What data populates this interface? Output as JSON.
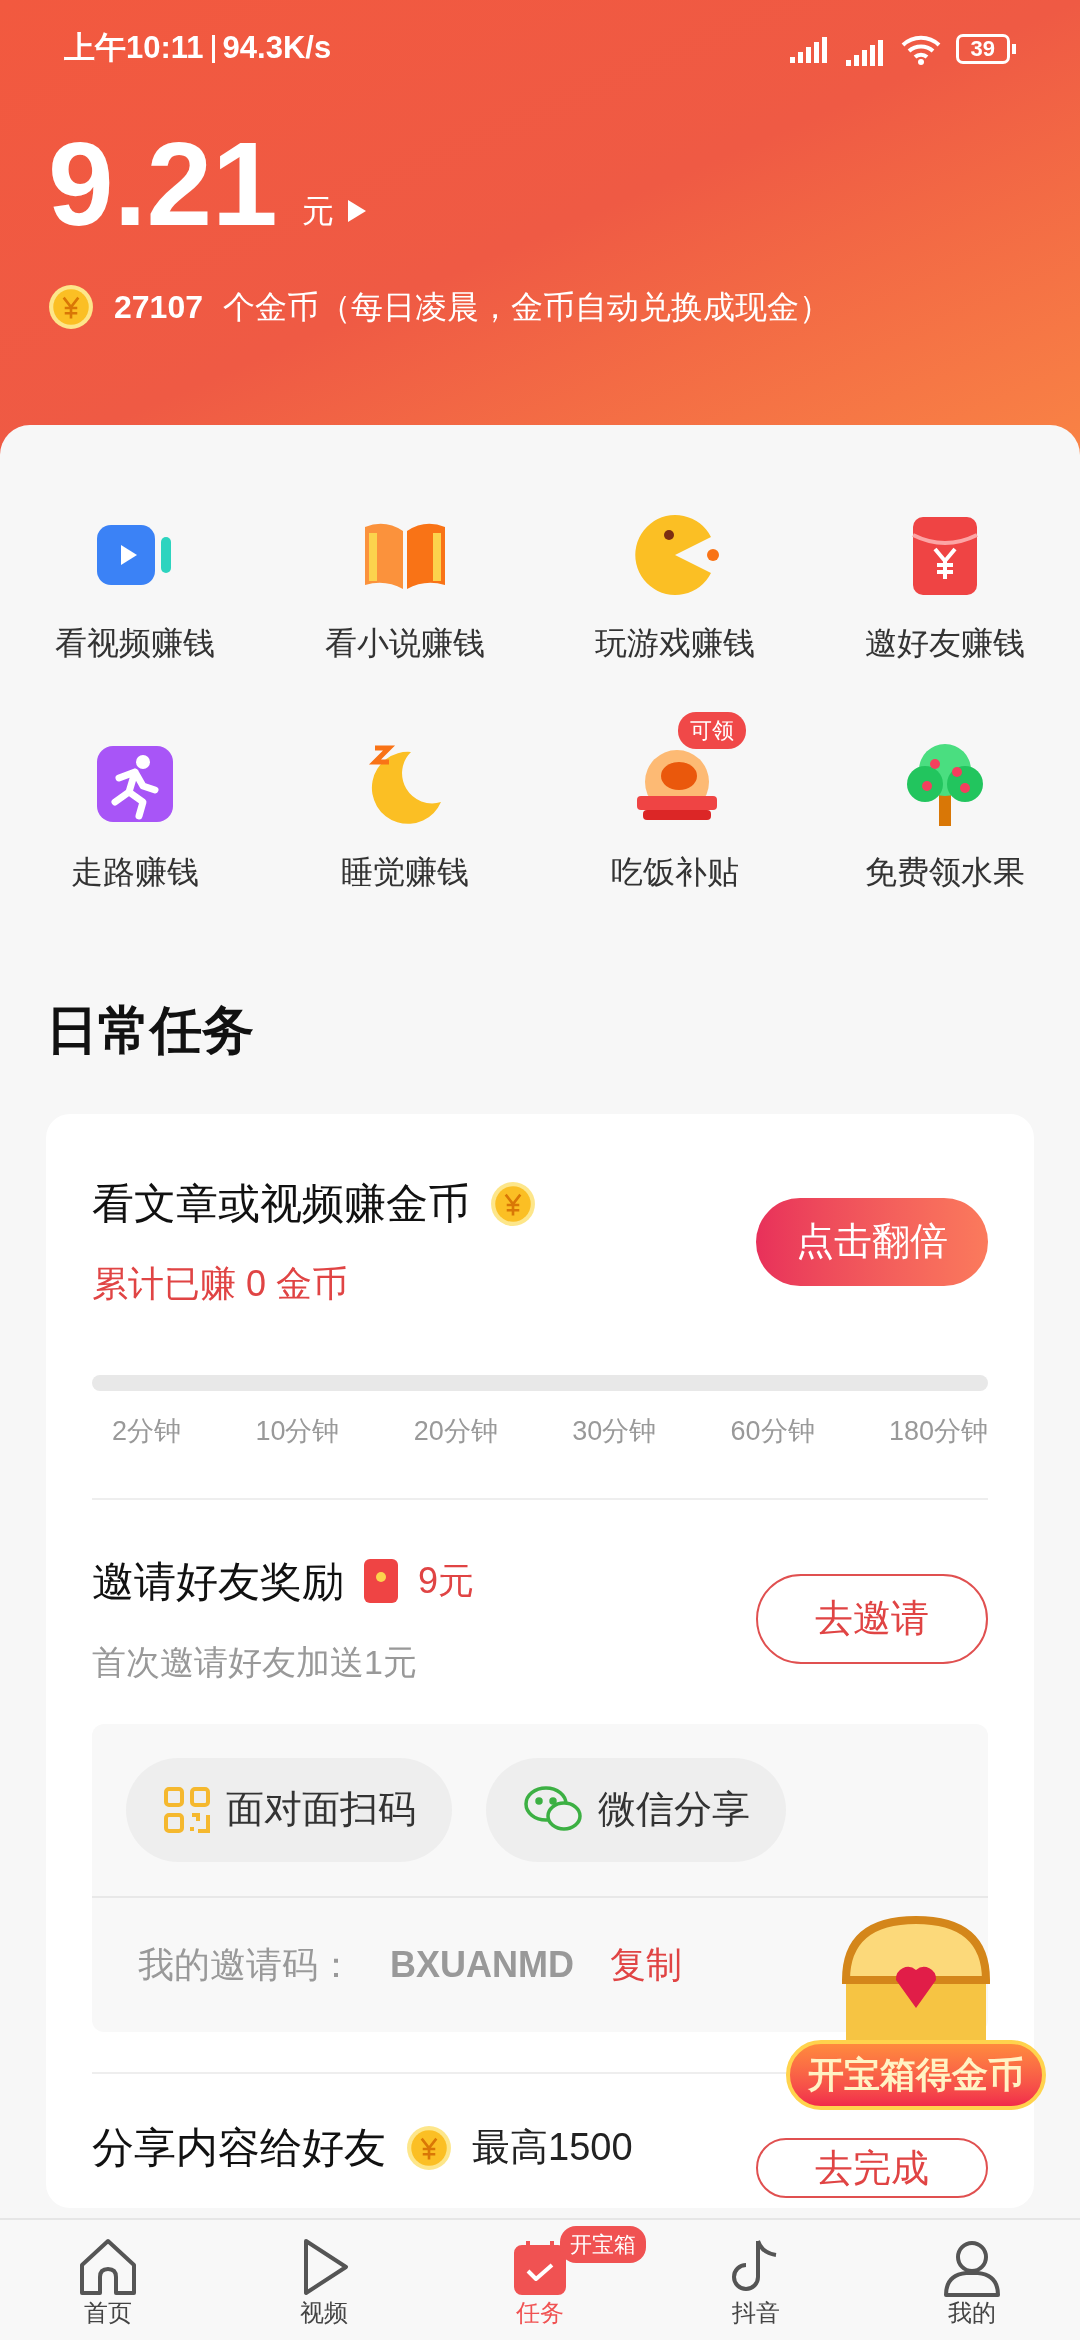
{
  "status_bar": {
    "time": "上午10:11",
    "speed": "94.3K/s",
    "battery": "39"
  },
  "balance": {
    "amount": "9.21",
    "unit": "元",
    "coins": "27107",
    "coins_text": "个金币（每日凌晨，金币自动兑换成现金）"
  },
  "shortcuts": [
    {
      "kind": "video",
      "label": "看视频赚钱"
    },
    {
      "kind": "novel",
      "label": "看小说赚钱"
    },
    {
      "kind": "game",
      "label": "玩游戏赚钱"
    },
    {
      "kind": "invite",
      "label": "邀好友赚钱"
    },
    {
      "kind": "walk",
      "label": "走路赚钱"
    },
    {
      "kind": "sleep",
      "label": "睡觉赚钱"
    },
    {
      "kind": "meal",
      "label": "吃饭补贴",
      "badge": "可领"
    },
    {
      "kind": "tree",
      "label": "免费领水果"
    }
  ],
  "daily_tasks": {
    "title": "日常任务",
    "watch": {
      "title": "看文章或视频赚金币",
      "earned": "累计已赚 0 金币",
      "button": "点击翻倍",
      "level": 0,
      "steps": [
        "2分钟",
        "10分钟",
        "20分钟",
        "30分钟",
        "60分钟",
        "180分钟"
      ]
    },
    "invite": {
      "title": "邀请好友奖励",
      "reward": "9元",
      "subtitle": "首次邀请好友加送1元",
      "button": "去邀请",
      "share_buttons": [
        {
          "kind": "qr",
          "label": "面对面扫码"
        },
        {
          "kind": "wechat",
          "label": "微信分享"
        }
      ],
      "code_label": "我的邀请码：",
      "code": "BXUANMD",
      "copy": "复制"
    },
    "share": {
      "title": "分享内容给好友",
      "reward": "最高1500",
      "button": "去完成"
    }
  },
  "treasure": {
    "label": "开宝箱得金币"
  },
  "bottom_nav": [
    {
      "kind": "home",
      "label": "首页",
      "selected": false
    },
    {
      "kind": "play",
      "label": "视频",
      "selected": false
    },
    {
      "kind": "task",
      "label": "任务",
      "selected": true,
      "badge": "开宝箱"
    },
    {
      "kind": "tiktok",
      "label": "抖音",
      "selected": false
    },
    {
      "kind": "user",
      "label": "我的",
      "selected": false
    }
  ]
}
